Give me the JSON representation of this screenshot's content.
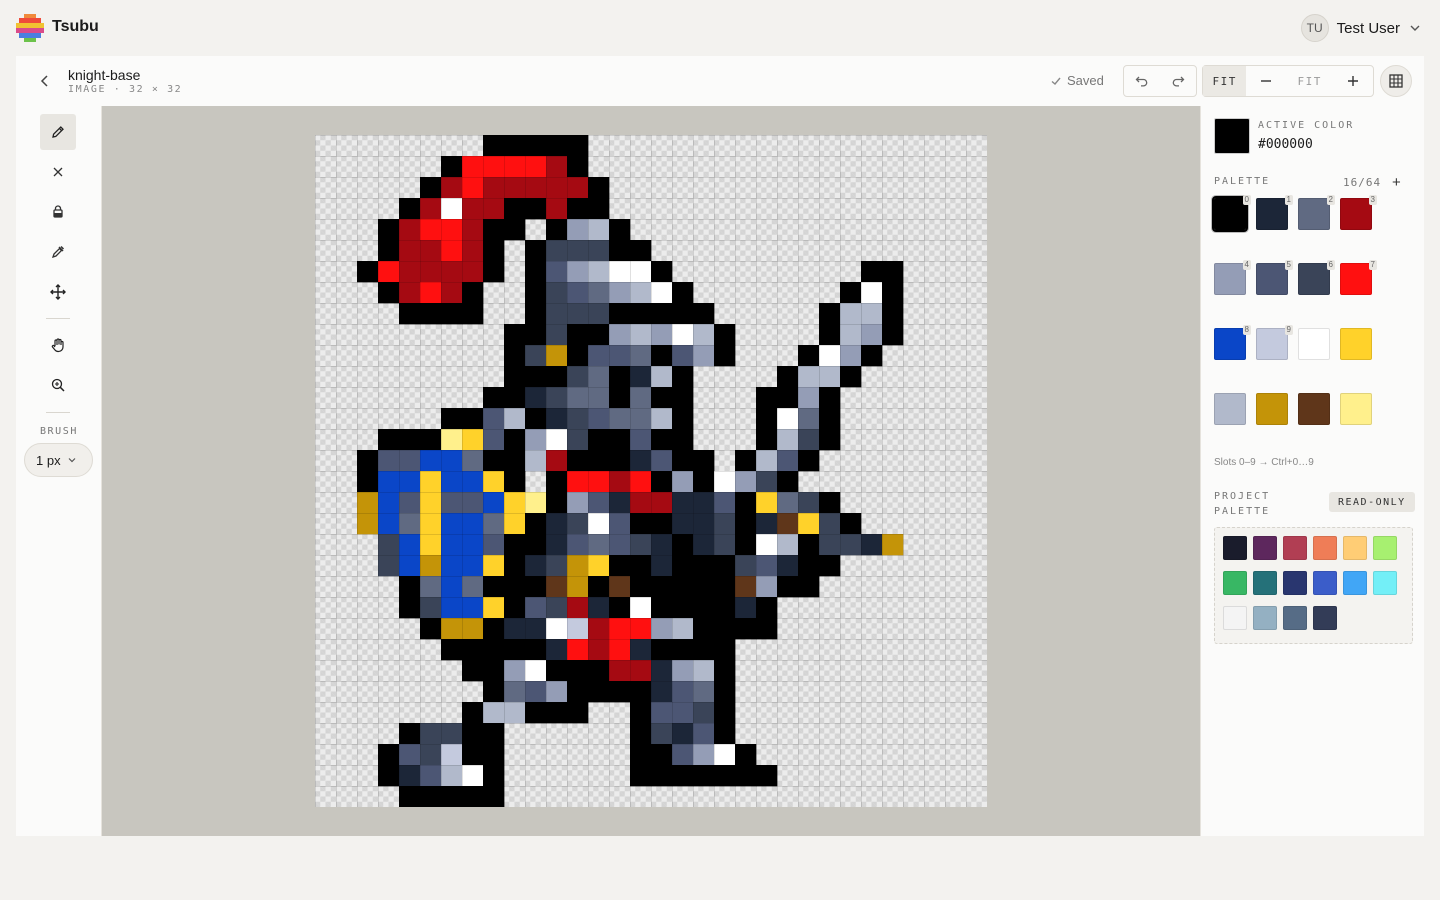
{
  "app": {
    "brand": "Tsubu"
  },
  "user": {
    "initials": "TU",
    "name": "Test User"
  },
  "file": {
    "title": "knight-base",
    "subtitle": "IMAGE · 32 × 32"
  },
  "status": {
    "saved": "Saved"
  },
  "zoom": {
    "fit_label": "FIT",
    "level": "FIT"
  },
  "brush": {
    "label": "BRUSH",
    "size": "1 px"
  },
  "tools": [
    {
      "name": "pencil",
      "icon": "pencil-icon",
      "active": true
    },
    {
      "name": "eraser",
      "icon": "eraser-icon",
      "active": false
    },
    {
      "name": "fill",
      "icon": "bucket-icon",
      "active": false
    },
    {
      "name": "eyedropper",
      "icon": "eyedropper-icon",
      "active": false
    },
    {
      "name": "move",
      "icon": "move-icon",
      "active": false
    },
    {
      "name": "pan",
      "icon": "hand-icon",
      "active": false
    },
    {
      "name": "zoom",
      "icon": "zoom-icon",
      "active": false
    }
  ],
  "active_color": {
    "label": "ACTIVE COLOR",
    "hex": "#000000"
  },
  "palette": {
    "label": "PALETTE",
    "count": "16/64",
    "add_label": "+",
    "hint": "Slots 0–9 → Ctrl+0…9",
    "colors": [
      "#000000",
      "#1c2638",
      "#606a82",
      "#a50a12",
      "#949db6",
      "#4c5674",
      "#3a4458",
      "#ff1010",
      "#0a46c8",
      "#c4cade",
      "#ffffff",
      "#ffd22a",
      "#b1b9cb",
      "#c49408",
      "#5f361a",
      "#fff08c"
    ],
    "selected": 0
  },
  "project_palette": {
    "label": "PROJECT PALETTE",
    "badge": "READ-ONLY",
    "colors": [
      "#1a1c2c",
      "#5d275d",
      "#b13e53",
      "#ef7d57",
      "#ffcd75",
      "#a7f070",
      "#38b764",
      "#257179",
      "#29366f",
      "#3b5dc9",
      "#41a6f6",
      "#73eff7",
      "#f4f4f4",
      "#94b0c2",
      "#566c86",
      "#333c57"
    ]
  },
  "sprite": {
    "palette": {
      "K": "#000000",
      "R": "#ff1010",
      "r": "#a50a12",
      "N": "#1c2638",
      "S": "#606a82",
      "s": "#949db6",
      "D": "#3a4458",
      "L": "#b1b9cb",
      "l": "#c4cade",
      "W": "#ffffff",
      "B": "#0a46c8",
      "Y": "#ffd22a",
      "y": "#fff08c",
      "G": "#c49408",
      "O": "#5f361a",
      "M": "#4c5674"
    },
    "rows": [
      "........KKKKK...................",
      "......KRRRRrK...................",
      ".....KrRrrrrrK..................",
      "....KrWrrKKrKK..................",
      "...KrRRrKK.KsLK.................",
      "...KrrRrK.KDDDKK................",
      "..KRrrrrK.KMsLWWK.........KK....",
      "...KrRrK..KDMSsLWK.......KWK....",
      "....KKKK..KDDDKKKKK.....KLLK....",
      ".........KKDKKsLsWLK....KLsK....",
      ".........KDGKMMSKMsK...KWsK.....",
      ".........KKKDSKNLK....KLLK......",
      "........KKNDSSKSKK...KKsK.......",
      "......KKMLKNDMSSLK...KWSK.......",
      "...KKKyYMKsWDKKMKK...KLDK.......",
      "..KMMBBSKKLrKKKNMKK.KLMK........",
      "..KBBYBBYK.KRRrRKsKWsDK.........",
      "..GBMYMMBYyKsMNrrNNMKYSDK.......",
      "..GBSYBBSYKNDWMKKNNDKNOYDK......",
      "...DBYBBMKKNMSMDNKNDKWLKDDNG....",
      "...DBGBBYKNDGYKKNKKKDMNKK.......",
      "....KSBSKKKOGKOKKKKKOsKK........",
      "....KDBBYKMDrNKWKKKKNK..........",
      ".....KGGKNNWlrRRsLKKKK..........",
      "......KKKKKNRrRNKKKK............",
      ".......KKsWKKKrrNsLK............",
      "........KSMsKKKKNMSK............",
      ".......KLLKKK..KMMDK............",
      "....KDDKK......KDNMK............",
      "...KMDlKK......KKMsWK...........",
      "...KNMLWK......KKKKKKK..........",
      "....KKKKK.......................",
      "................................"
    ]
  }
}
